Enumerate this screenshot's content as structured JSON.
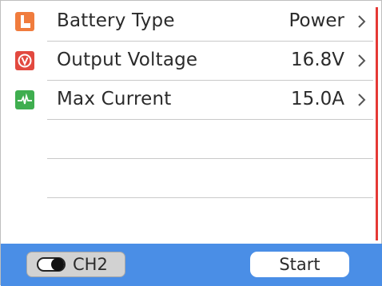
{
  "settings": {
    "rows": [
      {
        "label": "Battery Type",
        "value": "Power",
        "icon": "battery-type-icon",
        "icon_color": "#f07c3d"
      },
      {
        "label": "Output Voltage",
        "value": "16.8V",
        "icon": "voltage-icon",
        "icon_color": "#e2493f"
      },
      {
        "label": "Max Current",
        "value": "15.0A",
        "icon": "current-waveform-icon",
        "icon_color": "#3fae4f"
      }
    ]
  },
  "bottom_bar": {
    "channel_label": "CH2",
    "start_label": "Start",
    "color": "#4a8ee6"
  },
  "scrollbar": {
    "color": "#e53935"
  }
}
